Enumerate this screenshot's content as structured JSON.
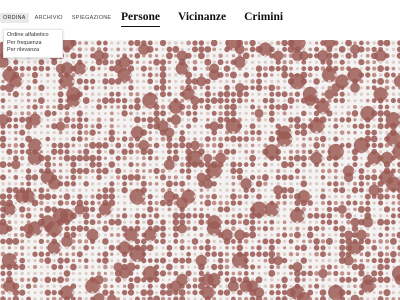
{
  "nav": {
    "items": [
      {
        "label": "ORDINA"
      },
      {
        "label": "ARCHIVIO"
      },
      {
        "label": "SPIEGAZIONE"
      }
    ]
  },
  "sort_menu": {
    "options": [
      {
        "label": "Ordine alfabetico"
      },
      {
        "label": "Per frequenza"
      },
      {
        "label": "Per rilevanza"
      }
    ]
  },
  "sections": {
    "tabs": [
      {
        "label": "Persone",
        "active": true
      },
      {
        "label": "Vicinanze",
        "active": false
      },
      {
        "label": "Crimini",
        "active": false
      }
    ]
  },
  "colors": {
    "dot_dark": "#9b5a55",
    "dot_mid": "#b77f7a",
    "dot_light": "#d8c9c6",
    "background": "#f5f3f2"
  }
}
